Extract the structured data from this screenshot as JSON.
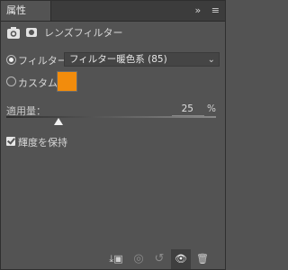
{
  "tabs": {
    "active_label": "属性",
    "more_icon": "»",
    "menu_icon": "≡"
  },
  "header": {
    "title": "レンズフィルター"
  },
  "filter_row": {
    "label": "フィルター：",
    "selected_option": "フィルター暖色系 (85)"
  },
  "custom_row": {
    "label": "カスタム：",
    "swatch_color": "#f28c0c"
  },
  "density": {
    "label": "適用量：",
    "value": "25",
    "unit": "%"
  },
  "preserve": {
    "label": "輝度を保持",
    "checked": true
  },
  "footer": {
    "clip_icon": "⤓▣",
    "view_previous_icon": "◎",
    "reset_icon": "↺",
    "visibility_icon": "👁",
    "trash_icon": "🗑"
  }
}
